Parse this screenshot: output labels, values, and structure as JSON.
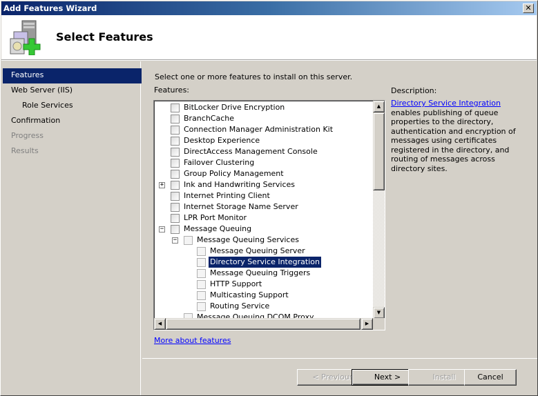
{
  "window": {
    "title": "Add Features Wizard",
    "close_label": "✕"
  },
  "header": {
    "title": "Select Features",
    "icon": "server-add-icon"
  },
  "sidebar": {
    "items": [
      {
        "label": "Features",
        "state": "active"
      },
      {
        "label": "Web Server (IIS)",
        "state": "normal"
      },
      {
        "label": "Role Services",
        "state": "sub"
      },
      {
        "label": "Confirmation",
        "state": "normal"
      },
      {
        "label": "Progress",
        "state": "disabled"
      },
      {
        "label": "Results",
        "state": "disabled"
      }
    ]
  },
  "main": {
    "intro": "Select one or more features to install on this server.",
    "features_label": "Features:",
    "features": [
      {
        "label": "BitLocker Drive Encryption",
        "level": 0,
        "expander": "",
        "checked": false
      },
      {
        "label": "BranchCache",
        "level": 0,
        "expander": "",
        "checked": false
      },
      {
        "label": "Connection Manager Administration Kit",
        "level": 0,
        "expander": "",
        "checked": false
      },
      {
        "label": "Desktop Experience",
        "level": 0,
        "expander": "",
        "checked": false
      },
      {
        "label": "DirectAccess Management Console",
        "level": 0,
        "expander": "",
        "checked": false
      },
      {
        "label": "Failover Clustering",
        "level": 0,
        "expander": "",
        "checked": false
      },
      {
        "label": "Group Policy Management",
        "level": 0,
        "expander": "",
        "checked": false
      },
      {
        "label": "Ink and Handwriting Services",
        "level": 0,
        "expander": "+",
        "checked": false
      },
      {
        "label": "Internet Printing Client",
        "level": 0,
        "expander": "",
        "checked": false
      },
      {
        "label": "Internet Storage Name Server",
        "level": 0,
        "expander": "",
        "checked": false
      },
      {
        "label": "LPR Port Monitor",
        "level": 0,
        "expander": "",
        "checked": false
      },
      {
        "label": "Message Queuing",
        "level": 0,
        "expander": "−",
        "checked": false
      },
      {
        "label": "Message Queuing Services",
        "level": 1,
        "expander": "−",
        "checked": false
      },
      {
        "label": "Message Queuing Server",
        "level": 2,
        "expander": "",
        "checked": false
      },
      {
        "label": "Directory Service Integration",
        "level": 2,
        "expander": "",
        "checked": false,
        "selected": true
      },
      {
        "label": "Message Queuing Triggers",
        "level": 2,
        "expander": "",
        "checked": false
      },
      {
        "label": "HTTP Support",
        "level": 2,
        "expander": "",
        "checked": false
      },
      {
        "label": "Multicasting Support",
        "level": 2,
        "expander": "",
        "checked": false
      },
      {
        "label": "Routing Service",
        "level": 2,
        "expander": "",
        "checked": false
      },
      {
        "label": "Message Queuing DCOM Proxy",
        "level": 1,
        "expander": "",
        "checked": false
      }
    ],
    "description_label": "Description:",
    "description_link": "Directory Service Integration",
    "description_text": " enables publishing of queue properties to the directory, authentication and encryption of messages using certificates registered in the directory, and routing of messages across directory sites.",
    "more_link": "More about features",
    "scroll": {
      "vertical_position": 0.0,
      "vertical_visible_fraction": 0.4
    }
  },
  "buttons": {
    "previous": "< Previous",
    "next": "Next >",
    "install": "Install",
    "cancel": "Cancel"
  }
}
